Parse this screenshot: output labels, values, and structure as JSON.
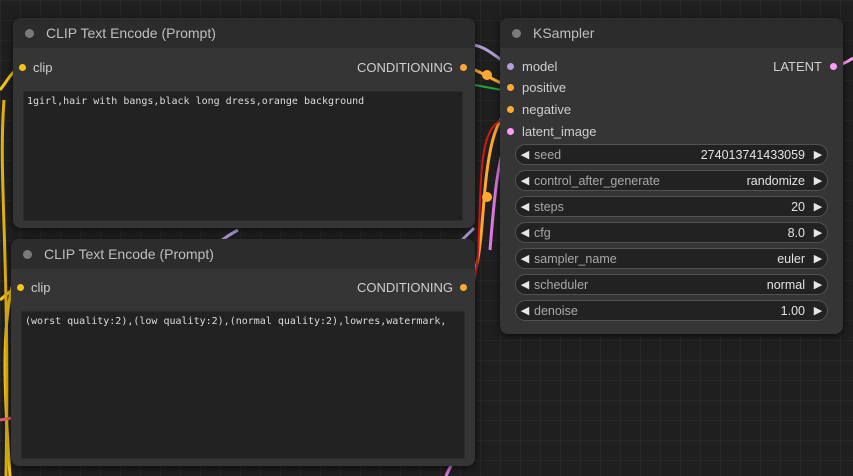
{
  "nodes": {
    "clip_positive": {
      "title": "CLIP Text Encode (Prompt)",
      "input_label": "clip",
      "output_label": "CONDITIONING",
      "text": "1girl,hair with bangs,black long dress,orange background"
    },
    "clip_negative": {
      "title": "CLIP Text Encode (Prompt)",
      "input_label": "clip",
      "output_label": "CONDITIONING",
      "text": "(worst quality:2),(low quality:2),(normal quality:2),lowres,watermark,"
    },
    "ksampler": {
      "title": "KSampler",
      "inputs": [
        "model",
        "positive",
        "negative",
        "latent_image"
      ],
      "output_label": "LATENT",
      "widgets": [
        {
          "label": "seed",
          "value": "274013741433059"
        },
        {
          "label": "control_after_generate",
          "value": "randomize"
        },
        {
          "label": "steps",
          "value": "20"
        },
        {
          "label": "cfg",
          "value": "8.0"
        },
        {
          "label": "sampler_name",
          "value": "euler"
        },
        {
          "label": "scheduler",
          "value": "normal"
        },
        {
          "label": "denoise",
          "value": "1.00"
        }
      ]
    }
  },
  "icons": {
    "arrow_left": "◀",
    "arrow_right": "▶"
  },
  "colors": {
    "clip_slot": "#f5c518",
    "conditioning_slot": "#ffa931",
    "model_slot": "#b39ddb",
    "latent_slot": "#ff9cf9",
    "annotation_green": "#1fa83a",
    "annotation_red": "#d41a1a"
  }
}
